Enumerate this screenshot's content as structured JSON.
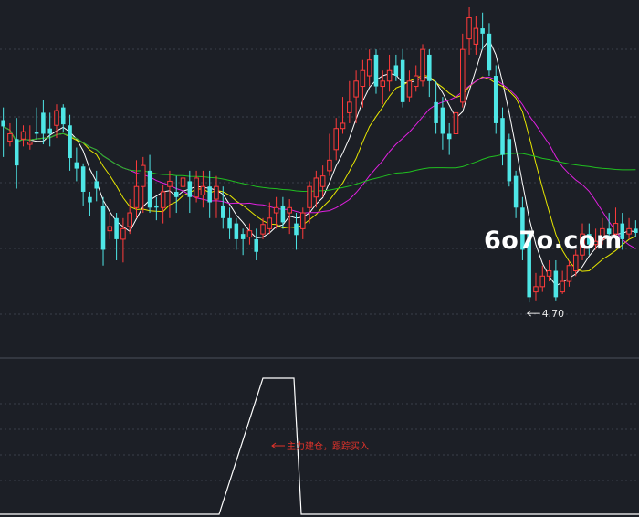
{
  "chart_data": [
    {
      "type": "candlestick",
      "title": "",
      "xlabel": "",
      "ylabel": "",
      "grid": true,
      "colors": {
        "up": "#ff3b3b",
        "down": "#4ee6e6",
        "background": "#1c1f26",
        "grid": "#3a3f4a"
      },
      "ylim": [
        4.45,
        7.5
      ],
      "annotation": {
        "label": "4.70",
        "value": 4.7,
        "bar": 79
      },
      "candles": [
        [
          6.43,
          6.37,
          6.55,
          6.08
        ],
        [
          6.23,
          6.3,
          6.4,
          6.18
        ],
        [
          6.25,
          6.0,
          6.45,
          5.78
        ],
        [
          6.25,
          6.32,
          6.38,
          6.18
        ],
        [
          6.2,
          6.22,
          6.38,
          6.15
        ],
        [
          6.32,
          6.3,
          6.55,
          6.25
        ],
        [
          6.5,
          6.3,
          6.62,
          6.2
        ],
        [
          6.35,
          6.3,
          6.5,
          6.18
        ],
        [
          6.38,
          6.52,
          6.58,
          6.26
        ],
        [
          6.55,
          6.39,
          6.58,
          6.32
        ],
        [
          6.38,
          6.07,
          6.48,
          5.95
        ],
        [
          6.03,
          5.97,
          6.17,
          5.85
        ],
        [
          5.99,
          5.75,
          6.02,
          5.62
        ],
        [
          5.7,
          5.65,
          5.75,
          5.52
        ],
        [
          5.85,
          5.78,
          5.95,
          5.66
        ],
        [
          5.62,
          5.2,
          5.7,
          5.05
        ],
        [
          5.38,
          5.42,
          5.55,
          5.3
        ],
        [
          5.5,
          5.3,
          5.55,
          5.1
        ],
        [
          5.3,
          5.4,
          5.5,
          5.08
        ],
        [
          5.42,
          5.55,
          5.68,
          5.35
        ],
        [
          5.6,
          5.8,
          6.05,
          5.5
        ],
        [
          5.8,
          6.0,
          6.08,
          5.55
        ],
        [
          5.95,
          5.6,
          6.1,
          5.55
        ],
        [
          5.62,
          5.6,
          5.7,
          5.48
        ],
        [
          5.6,
          5.75,
          5.82,
          5.45
        ],
        [
          5.8,
          5.85,
          5.95,
          5.5
        ],
        [
          5.75,
          5.7,
          5.9,
          5.55
        ],
        [
          5.8,
          5.88,
          5.95,
          5.6
        ],
        [
          5.85,
          5.7,
          5.95,
          5.55
        ],
        [
          5.7,
          5.88,
          5.95,
          5.65
        ],
        [
          5.72,
          5.8,
          5.95,
          5.6
        ],
        [
          5.8,
          5.65,
          5.95,
          5.5
        ],
        [
          5.68,
          5.8,
          5.9,
          5.5
        ],
        [
          5.62,
          5.5,
          5.8,
          5.4
        ],
        [
          5.5,
          5.4,
          5.6,
          5.3
        ],
        [
          5.45,
          5.3,
          5.5,
          5.2
        ],
        [
          5.35,
          5.3,
          5.4,
          5.15
        ],
        [
          5.32,
          5.38,
          5.45,
          5.25
        ],
        [
          5.3,
          5.18,
          5.4,
          5.1
        ],
        [
          5.35,
          5.44,
          5.5,
          5.3
        ],
        [
          5.4,
          5.5,
          5.65,
          5.35
        ],
        [
          5.55,
          5.6,
          5.7,
          5.4
        ],
        [
          5.62,
          5.46,
          5.7,
          5.4
        ],
        [
          5.55,
          5.6,
          5.68,
          5.35
        ],
        [
          5.45,
          5.34,
          5.55,
          5.2
        ],
        [
          5.4,
          5.55,
          5.6,
          5.3
        ],
        [
          5.6,
          5.8,
          5.85,
          5.45
        ],
        [
          5.7,
          5.88,
          5.95,
          5.6
        ],
        [
          5.8,
          5.9,
          6.0,
          5.7
        ],
        [
          5.95,
          6.05,
          6.3,
          5.9
        ],
        [
          6.15,
          6.35,
          6.45,
          6.05
        ],
        [
          6.35,
          6.4,
          6.65,
          6.3
        ],
        [
          6.5,
          6.6,
          6.8,
          6.4
        ],
        [
          6.65,
          6.8,
          6.9,
          6.4
        ],
        [
          6.75,
          6.9,
          7.0,
          6.55
        ],
        [
          6.85,
          7.0,
          7.1,
          6.75
        ],
        [
          7.05,
          6.75,
          7.1,
          6.68
        ],
        [
          6.75,
          6.8,
          6.9,
          6.58
        ],
        [
          6.8,
          6.9,
          7.05,
          6.7
        ],
        [
          6.95,
          6.85,
          7.05,
          6.8
        ],
        [
          7.0,
          6.6,
          7.1,
          6.55
        ],
        [
          6.65,
          6.8,
          6.9,
          6.6
        ],
        [
          6.75,
          6.85,
          6.95,
          6.7
        ],
        [
          6.8,
          7.1,
          7.15,
          6.75
        ],
        [
          7.05,
          6.8,
          7.1,
          6.65
        ],
        [
          6.6,
          6.4,
          6.8,
          6.3
        ],
        [
          6.55,
          6.3,
          6.65,
          6.15
        ],
        [
          6.3,
          6.25,
          6.4,
          6.1
        ],
        [
          6.3,
          6.5,
          6.6,
          6.25
        ],
        [
          6.6,
          7.1,
          7.25,
          6.55
        ],
        [
          7.2,
          7.4,
          7.5,
          7.05
        ],
        [
          7.15,
          7.3,
          7.42,
          7.05
        ],
        [
          7.3,
          7.25,
          7.45,
          7.1
        ],
        [
          7.25,
          6.9,
          7.35,
          6.85
        ],
        [
          6.85,
          6.4,
          6.95,
          6.3
        ],
        [
          6.45,
          6.1,
          6.55,
          6.0
        ],
        [
          6.25,
          5.85,
          6.3,
          5.8
        ],
        [
          5.9,
          5.6,
          5.95,
          5.5
        ],
        [
          5.6,
          5.2,
          5.7,
          5.1
        ],
        [
          5.35,
          4.75,
          5.4,
          4.7
        ],
        [
          4.8,
          4.85,
          4.98,
          4.72
        ],
        [
          4.85,
          4.95,
          5.05,
          4.8
        ],
        [
          4.95,
          5.0,
          5.1,
          4.9
        ],
        [
          5.0,
          4.75,
          5.1,
          4.72
        ],
        [
          4.8,
          4.9,
          5.0,
          4.78
        ],
        [
          4.9,
          5.05,
          5.1,
          4.85
        ],
        [
          5.0,
          5.15,
          5.2,
          4.95
        ],
        [
          5.15,
          5.35,
          5.45,
          5.1
        ],
        [
          5.35,
          5.25,
          5.45,
          5.15
        ],
        [
          5.25,
          5.28,
          5.4,
          5.2
        ],
        [
          5.3,
          5.4,
          5.5,
          5.25
        ],
        [
          5.4,
          5.35,
          5.55,
          5.3
        ],
        [
          5.35,
          5.45,
          5.6,
          5.3
        ],
        [
          5.45,
          5.3,
          5.55,
          5.2
        ],
        [
          5.35,
          5.4,
          5.5,
          5.3
        ],
        [
          5.4,
          5.36,
          5.48,
          5.32
        ]
      ],
      "moving_averages": [
        {
          "period": 5,
          "color": "#ffffff"
        },
        {
          "period": 10,
          "color": "#e8e800"
        },
        {
          "period": 20,
          "color": "#e020e0"
        },
        {
          "period": 60,
          "color": "#20c020"
        }
      ]
    },
    {
      "type": "line",
      "title": "",
      "grid": true,
      "ylim": [
        0,
        1
      ],
      "series": [
        {
          "x": [
            0,
            1,
            2,
            3,
            4,
            5,
            6,
            7,
            8,
            9,
            10
          ],
          "values": [
            0,
            0,
            0,
            0,
            0,
            1,
            1,
            0,
            0,
            0,
            0
          ]
        }
      ],
      "signal": {
        "label": "主力建仓，跟踪买入",
        "color": "#e0332b"
      }
    }
  ],
  "watermark": {
    "text": "6o7o.com"
  }
}
